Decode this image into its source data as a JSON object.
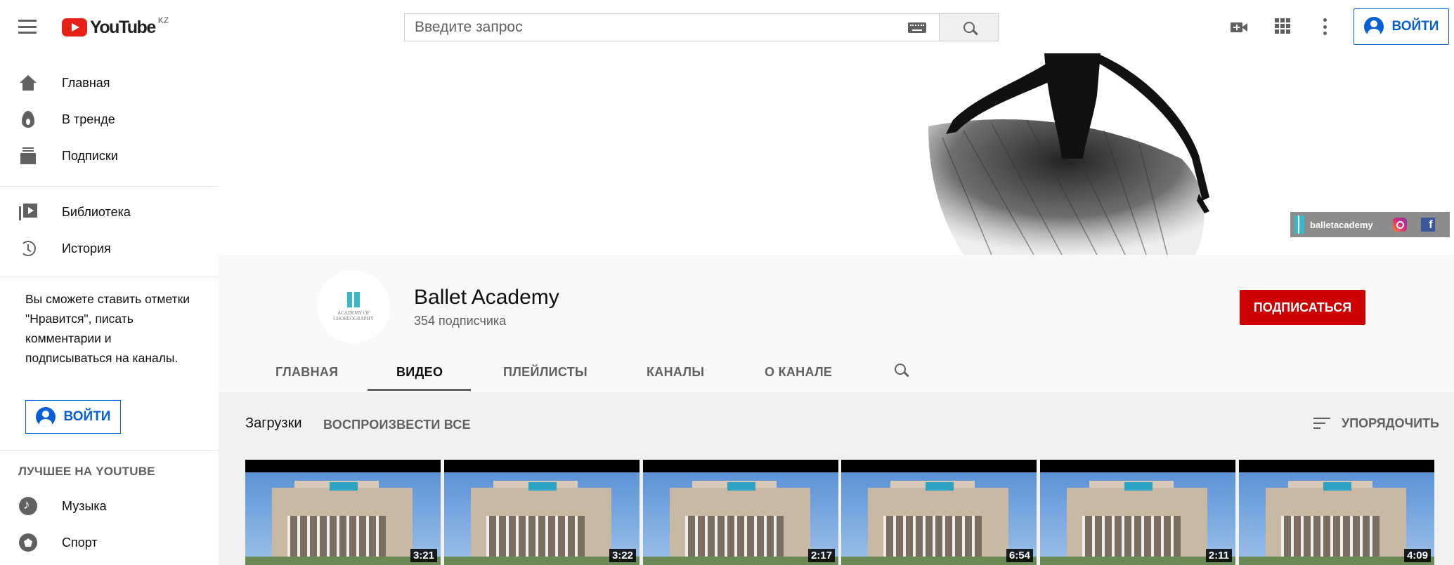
{
  "header": {
    "logo_text": "YouTube",
    "logo_country": "KZ",
    "search_placeholder": "Введите запрос",
    "signin_label": "ВОЙТИ"
  },
  "sidebar": {
    "items": [
      {
        "label": "Главная",
        "icon": "home-icon"
      },
      {
        "label": "В тренде",
        "icon": "fire-icon"
      },
      {
        "label": "Подписки",
        "icon": "subscriptions-icon"
      },
      {
        "label": "Библиотека",
        "icon": "library-icon"
      },
      {
        "label": "История",
        "icon": "history-icon"
      }
    ],
    "note": "Вы сможете ставить отметки \"Нравится\", писать комментарии и подписываться на каналы.",
    "signin_label": "ВОЙТИ",
    "section_title": "ЛУЧШЕЕ НА YOUTUBE",
    "best": [
      {
        "label": "Музыка",
        "icon": "music-icon"
      },
      {
        "label": "Спорт",
        "icon": "sport-icon"
      }
    ]
  },
  "banner": {
    "handle": "balletacademy"
  },
  "channel": {
    "name": "Ballet Academy",
    "subscribers": "354 подписчика",
    "avatar_text": "ACADEMY OF CHOREOGRAPHY",
    "subscribe_label": "ПОДПИСАТЬСЯ",
    "tabs": [
      "ГЛАВНАЯ",
      "ВИДЕО",
      "ПЛЕЙЛИСТЫ",
      "КАНАЛЫ",
      "О КАНАЛЕ"
    ],
    "active_tab": "ВИДЕО"
  },
  "content": {
    "section_title": "Загрузки",
    "play_all_label": "ВОСПРОИЗВЕСТИ ВСЕ",
    "sort_label": "УПОРЯДОЧИТЬ",
    "videos": [
      {
        "duration": "3:21"
      },
      {
        "duration": "3:22"
      },
      {
        "duration": "2:17"
      },
      {
        "duration": "6:54"
      },
      {
        "duration": "2:11"
      },
      {
        "duration": "4:09"
      }
    ]
  },
  "colors": {
    "accent_blue": "#065fd4",
    "subscribe_red": "#cc0000",
    "youtube_red": "#e62117"
  }
}
